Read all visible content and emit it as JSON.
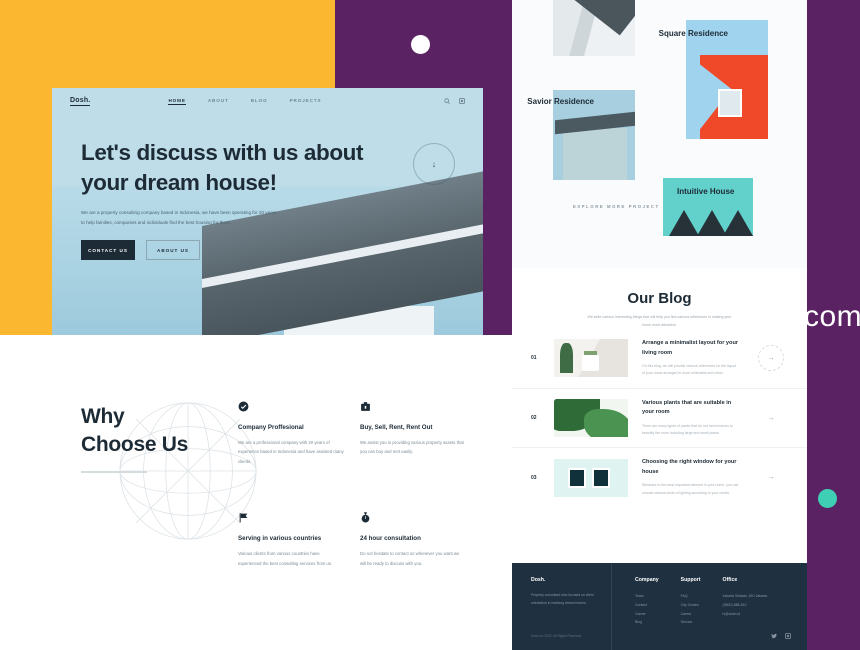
{
  "canvas": {
    "colors": {
      "yellow": "#fcb731",
      "purple": "#5a2262",
      "teal_dot": "#3fcfb4",
      "hero_bg": "#bfdde8",
      "dark": "#1d2b36",
      "footer_bg": "#1f3040"
    },
    "floating_text": "com"
  },
  "hero": {
    "logo": "Dosh.",
    "nav": [
      {
        "label": "HOME",
        "active": true
      },
      {
        "label": "ABOUT",
        "active": false
      },
      {
        "label": "BLOG",
        "active": false
      },
      {
        "label": "PROJECTS",
        "active": false
      }
    ],
    "nav_icons": [
      "search-icon",
      "instagram-icon"
    ],
    "title": "Let's discuss with us about your dream house!",
    "paragraph": "We are a property consulting company based in Indonesia, we have been operating for 20 years to help families, companies and individuals find the best housing for them.",
    "buttons": {
      "primary": "CONTACT US",
      "secondary": "ABOUT US"
    },
    "scroll_indicator": "↓"
  },
  "why": {
    "title": "Why Choose Us",
    "features": [
      {
        "icon": "check-badge-icon",
        "title": "Company Proffesional",
        "text": "We are a professional company with 20 years of experience based in Indonesia and have assisted many clients."
      },
      {
        "icon": "briefcase-icon",
        "title": "Buy, Sell, Rent, Rent Out",
        "text": "We assist you in providing various property assets that you can buy and rent easily."
      },
      {
        "icon": "flag-icon",
        "title": "Serving in various countries",
        "text": "Various clients from various countries have experienced the best consulting services from us."
      },
      {
        "icon": "stopwatch-icon",
        "title": "24 hour consultation",
        "text": "Do not hesitate to contact us whenever you want we will be ready to discuss with you."
      }
    ]
  },
  "projects": {
    "items": [
      {
        "label": "Square Residence"
      },
      {
        "label": "Savior Residence"
      },
      {
        "label": "Intuitive House"
      }
    ],
    "explore_label": "EXPLORE MORE PROJECT"
  },
  "blog": {
    "heading": "Our Blog",
    "subtitle": "We write various interesting things that will help you find various references in making your home more attractive.",
    "posts": [
      {
        "number": "01",
        "title": "Arrange a minimalist layout for your living room",
        "excerpt": "On this blog, we will provide various references for the layout of your home arranged in more minimalist and clean.",
        "arrow": "→"
      },
      {
        "number": "02",
        "title": "Various plants that are suitable in your room",
        "excerpt": "There are many types of plants that do not need indoors to beautify the room including large and small plants.",
        "arrow": "→"
      },
      {
        "number": "03",
        "title": "Choosing the right window for your house",
        "excerpt": "Windows is the most important element in your home, you can choose various kinds of lighting according to your needs.",
        "arrow": "→"
      }
    ]
  },
  "footer": {
    "logo": "Dosh.",
    "description": "Property consultant who focused on client orientation in realizing dream homes.",
    "copyright": "Dosh Inc 2020. All Rights Reserved",
    "columns": [
      {
        "heading": "Company",
        "links": [
          "Team",
          "Contact",
          "Career",
          "Blog"
        ]
      },
      {
        "heading": "Support",
        "links": [
          "FAQ",
          "City Guides",
          "Career",
          "Service"
        ]
      },
      {
        "heading": "Office",
        "links": [
          "Jakarta Selatan, DKI Jakarta",
          "(0800) 888-810",
          "hi@dosh.id"
        ]
      }
    ],
    "social": [
      "twitter-icon",
      "instagram-icon"
    ]
  }
}
